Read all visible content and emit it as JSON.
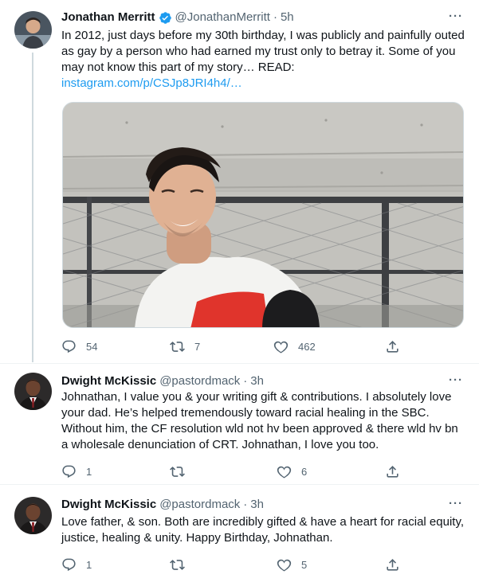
{
  "tweets": [
    {
      "name": "Jonathan Merritt",
      "handle": "@JonathanMerritt",
      "time": "5h",
      "verified": true,
      "text": "In 2012, just days before my 30th birthday, I was publicly and painfully outed as gay by a person who had earned my trust only to betray it. Some of you may not know this part of my story… READ:",
      "link": "instagram.com/p/CSJp8JRI4h4/…",
      "replies": "54",
      "retweets": "7",
      "likes": "462"
    },
    {
      "name": "Dwight McKissic",
      "handle": "@pastordmack",
      "time": "3h",
      "text": "Johnathan, I value you & your writing gift & contributions. I absolutely love your dad. He’s helped tremendously toward racial healing in the SBC. Without him, the CF resolution wld not hv been approved & there wld hv bn a wholesale denunciation of CRT. Johnathan, I love you too.",
      "replies": "1",
      "retweets": "",
      "likes": "6"
    },
    {
      "name": "Dwight McKissic",
      "handle": "@pastordmack",
      "time": "3h",
      "text": "Love father, & son. Both are incredibly gifted & have a heart for racial equity, justice, healing & unity. Happy Birthday, Johnathan.",
      "replies": "1",
      "retweets": "",
      "likes": "5"
    }
  ],
  "separator": "·",
  "more_glyph": "···",
  "colors": {
    "accent": "#1d9bf0",
    "secondary": "#536471",
    "border": "#cfd9de"
  },
  "icons": [
    "verified-badge-icon",
    "more-icon",
    "reply-icon",
    "retweet-icon",
    "like-icon",
    "share-icon"
  ]
}
